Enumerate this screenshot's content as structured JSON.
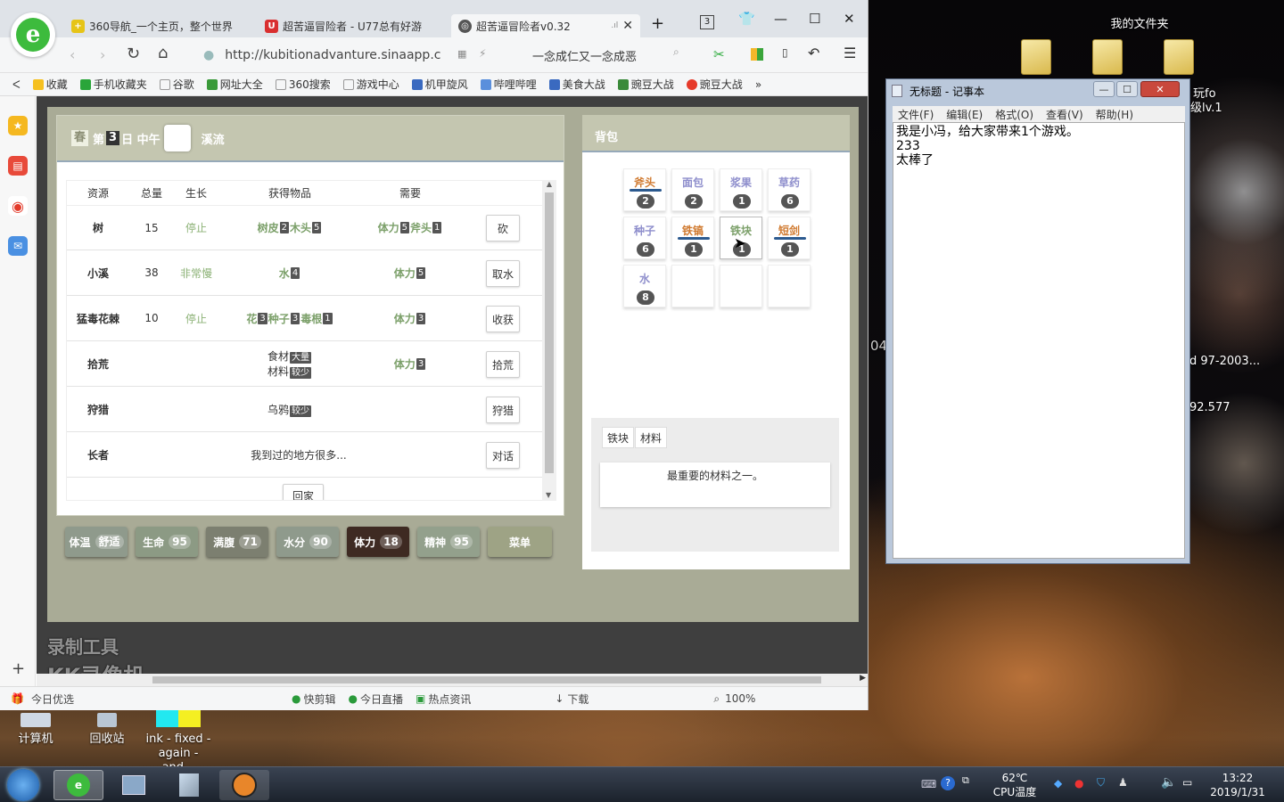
{
  "browser": {
    "tabs": [
      {
        "label": "360导航_一个主页，整个世界"
      },
      {
        "label": "超苦逼冒险者 - U77总有好游"
      },
      {
        "label": "超苦逼冒险者v0.32"
      }
    ],
    "tab_count": "3",
    "url": "http://kubitionadvanture.sinaapp.c",
    "search_text": "一念成仁又一念成恶",
    "bookmarks": [
      {
        "label": "收藏"
      },
      {
        "label": "手机收藏夹"
      },
      {
        "label": "谷歌"
      },
      {
        "label": "网址大全"
      },
      {
        "label": "360搜索"
      },
      {
        "label": "游戏中心"
      },
      {
        "label": "机甲旋风"
      },
      {
        "label": "哔哩哔哩"
      },
      {
        "label": "美食大战"
      },
      {
        "label": "豌豆大战"
      },
      {
        "label": "豌豆大战"
      }
    ],
    "status": {
      "left": "今日优选",
      "items": [
        "快剪辑",
        "今日直播",
        "热点资讯",
        "下载"
      ],
      "zoom": "100%"
    }
  },
  "game": {
    "header": {
      "season": "春",
      "day_prefix": "第",
      "day": "3",
      "day_suffix": "日 中午",
      "location": "溪流"
    },
    "columns": [
      "资源",
      "总量",
      "生长",
      "获得物品",
      "需要"
    ],
    "rows": [
      {
        "name": "树",
        "total": "15",
        "growth": "停止",
        "get": [
          [
            "树皮",
            "2"
          ],
          [
            "木头",
            "5"
          ]
        ],
        "need": [
          [
            "体力",
            "5"
          ],
          [
            "斧头",
            "1"
          ]
        ],
        "action": "砍"
      },
      {
        "name": "小溪",
        "total": "38",
        "growth": "非常慢",
        "get": [
          [
            "水",
            "4"
          ]
        ],
        "need": [
          [
            "体力",
            "5"
          ]
        ],
        "action": "取水"
      },
      {
        "name": "猛毒花棘",
        "total": "10",
        "growth": "停止",
        "get": [
          [
            "花",
            "3"
          ],
          [
            "种子",
            "3"
          ],
          [
            "毒根",
            "1"
          ]
        ],
        "need": [
          [
            "体力",
            "3"
          ]
        ],
        "action": "收获"
      },
      {
        "name": "拾荒",
        "total": "",
        "growth": "",
        "get2": [
          [
            "食材",
            "大量"
          ],
          [
            "材料",
            "较少"
          ]
        ],
        "need": [
          [
            "体力",
            "3"
          ]
        ],
        "action": "拾荒"
      },
      {
        "name": "狩猎",
        "total": "",
        "growth": "",
        "get2": [
          [
            "乌鸦",
            "较少"
          ]
        ],
        "need": [],
        "action": "狩猎"
      },
      {
        "name": "长者",
        "total": "",
        "growth": "",
        "text": "我到过的地方很多...",
        "need": [],
        "action": "对话"
      }
    ],
    "home_button": "回家",
    "stats": [
      {
        "label": "体温",
        "value": "舒适",
        "color": "#8f9a8c"
      },
      {
        "label": "生命",
        "value": "95",
        "color": "#8c9a84"
      },
      {
        "label": "满腹",
        "value": "71",
        "color": "#7c7f70"
      },
      {
        "label": "水分",
        "value": "90",
        "color": "#8f9a8c"
      },
      {
        "label": "体力",
        "value": "18",
        "color": "#3e2a22"
      },
      {
        "label": "精神",
        "value": "95",
        "color": "#93a08c"
      },
      {
        "label": "菜单",
        "value": "",
        "color": "#9ea385"
      }
    ],
    "bag_title": "背包",
    "bag": [
      {
        "name": "斧头",
        "count": "2",
        "color": "#d07a30",
        "bar": true
      },
      {
        "name": "面包",
        "count": "2",
        "color": "#8e8ecc",
        "bar": false
      },
      {
        "name": "浆果",
        "count": "1",
        "color": "#8e8ecc",
        "bar": false
      },
      {
        "name": "草药",
        "count": "6",
        "color": "#8e8ecc",
        "bar": false
      },
      {
        "name": "种子",
        "count": "6",
        "color": "#8e8ecc",
        "bar": false
      },
      {
        "name": "铁镐",
        "count": "1",
        "color": "#d07a30",
        "bar": true
      },
      {
        "name": "铁块",
        "count": "1",
        "color": "#7ca06a",
        "bar": false
      },
      {
        "name": "短剑",
        "count": "1",
        "color": "#d07a30",
        "bar": true
      },
      {
        "name": "水",
        "count": "8",
        "color": "#8e8ecc",
        "bar": false
      }
    ],
    "detail_tabs": [
      "铁块",
      "材料"
    ],
    "detail_text": "最重要的材料之一。"
  },
  "notepad": {
    "title": "无标题 - 记事本",
    "menu": [
      "文件(F)",
      "编辑(E)",
      "格式(O)",
      "查看(V)",
      "帮助(H)"
    ],
    "content": "我是小冯，给大家带来1个游戏。\n233\n太棒了"
  },
  "desktop": {
    "folder_label": "我的文件夹",
    "icons": [
      {
        "label": "计算机"
      },
      {
        "label": "回收站"
      },
      {
        "label": "ink - fixed - again - and..."
      }
    ],
    "side_texts": [
      "玩fo",
      "级lv.1",
      "04",
      "d 97-2003...",
      "92.577"
    ],
    "watermark": [
      "录制工具",
      "KK录像机"
    ]
  },
  "taskbar": {
    "cpu_temp": "62℃",
    "cpu_label": "CPU温度",
    "time": "13:22",
    "date": "2019/1/31"
  }
}
